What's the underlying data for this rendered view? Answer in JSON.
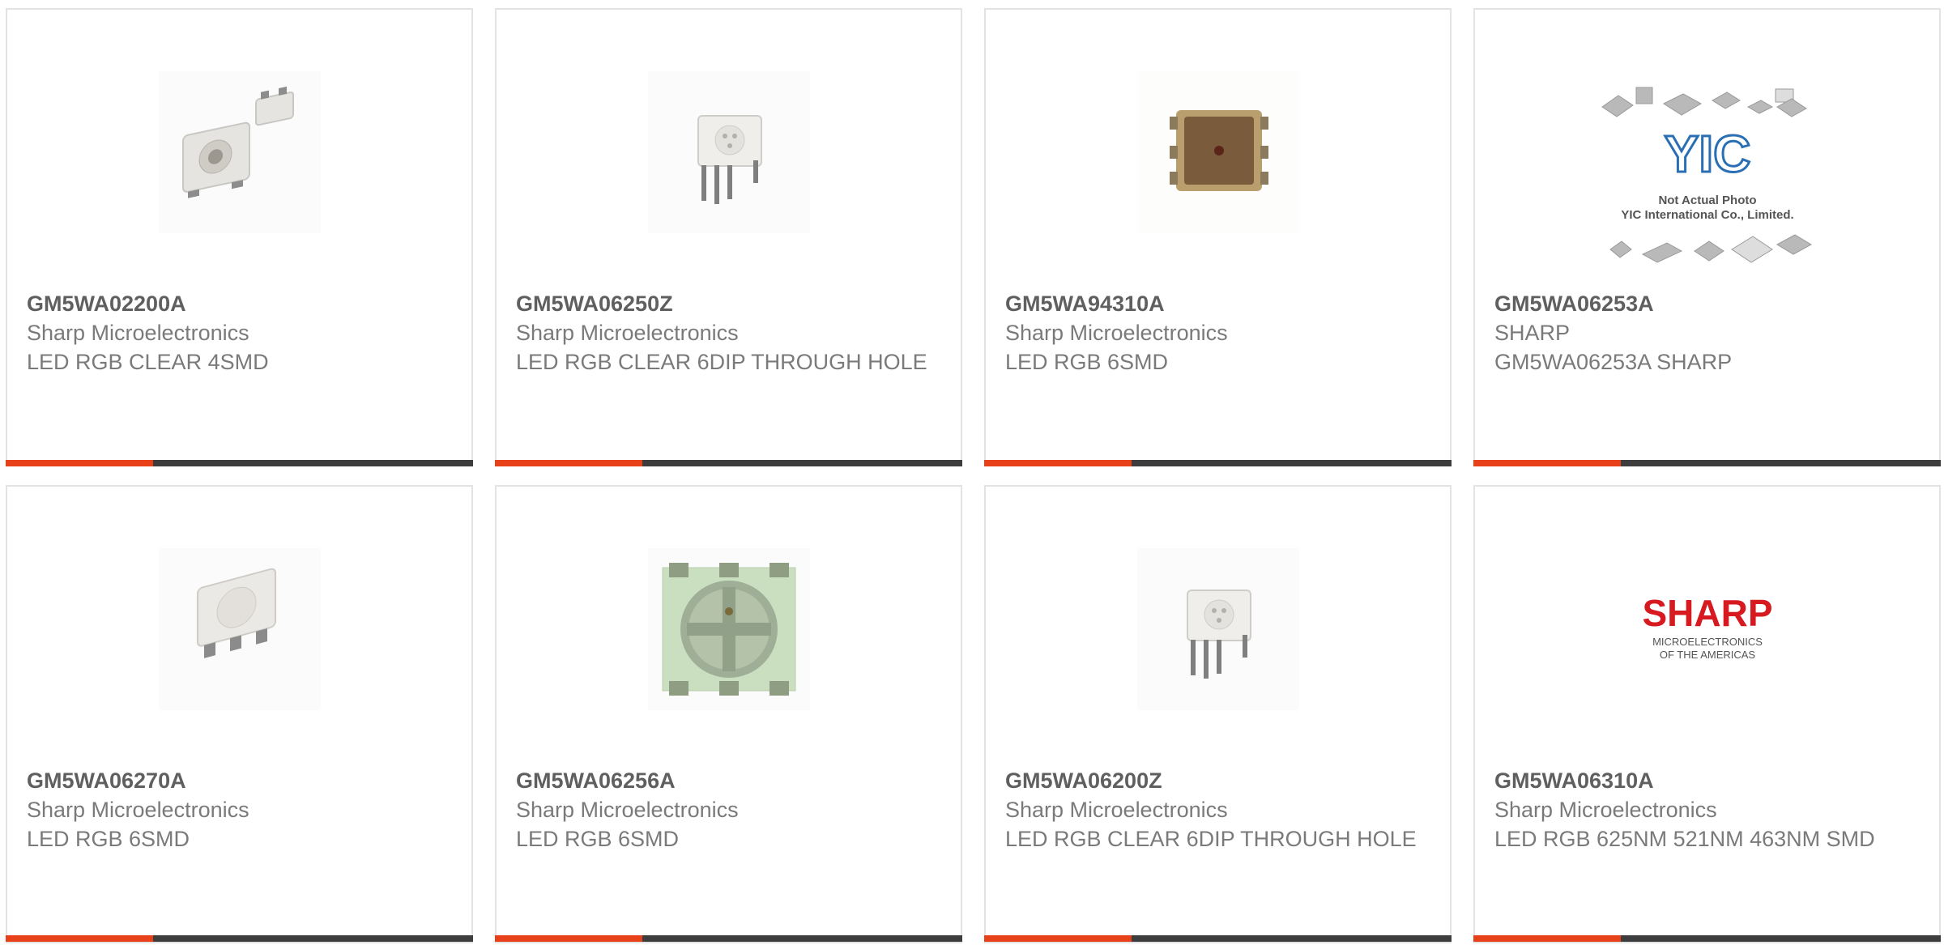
{
  "colors": {
    "accent": "#e8411a",
    "bar": "#3d3d3d",
    "text": "#7a7a7a",
    "border": "#e3e3e3"
  },
  "products": [
    {
      "part": "GM5WA02200A",
      "maker": "Sharp Microelectronics",
      "desc": "LED RGB CLEAR 4SMD",
      "image": "led-4smd-image"
    },
    {
      "part": "GM5WA06250Z",
      "maker": "Sharp Microelectronics",
      "desc": "LED RGB CLEAR 6DIP THROUGH HOLE",
      "image": "led-6dip-image"
    },
    {
      "part": "GM5WA94310A",
      "maker": "Sharp Microelectronics",
      "desc": "LED RGB 6SMD",
      "image": "led-6smd-brown-image"
    },
    {
      "part": "GM5WA06253A",
      "maker": "SHARP",
      "desc": "GM5WA06253A SHARP",
      "image": "placeholder-image",
      "placeholder": {
        "logo": "YIC",
        "line1": "Not Actual Photo",
        "line2": "YIC International Co., Limited."
      }
    },
    {
      "part": "GM5WA06270A",
      "maker": "Sharp Microelectronics",
      "desc": "LED RGB 6SMD",
      "image": "led-6smd-image"
    },
    {
      "part": "GM5WA06256A",
      "maker": "Sharp Microelectronics",
      "desc": "LED RGB 6SMD",
      "image": "led-6smd-green-image"
    },
    {
      "part": "GM5WA06200Z",
      "maker": "Sharp Microelectronics",
      "desc": "LED RGB CLEAR 6DIP THROUGH HOLE",
      "image": "led-6dip-image"
    },
    {
      "part": "GM5WA06310A",
      "maker": "Sharp Microelectronics",
      "desc": "LED RGB 625NM 521NM 463NM SMD",
      "image": "sharp-logo-image",
      "logo": {
        "brand": "SHARP",
        "line1": "MICROELECTRONICS",
        "line2": "OF THE AMERICAS"
      }
    }
  ]
}
